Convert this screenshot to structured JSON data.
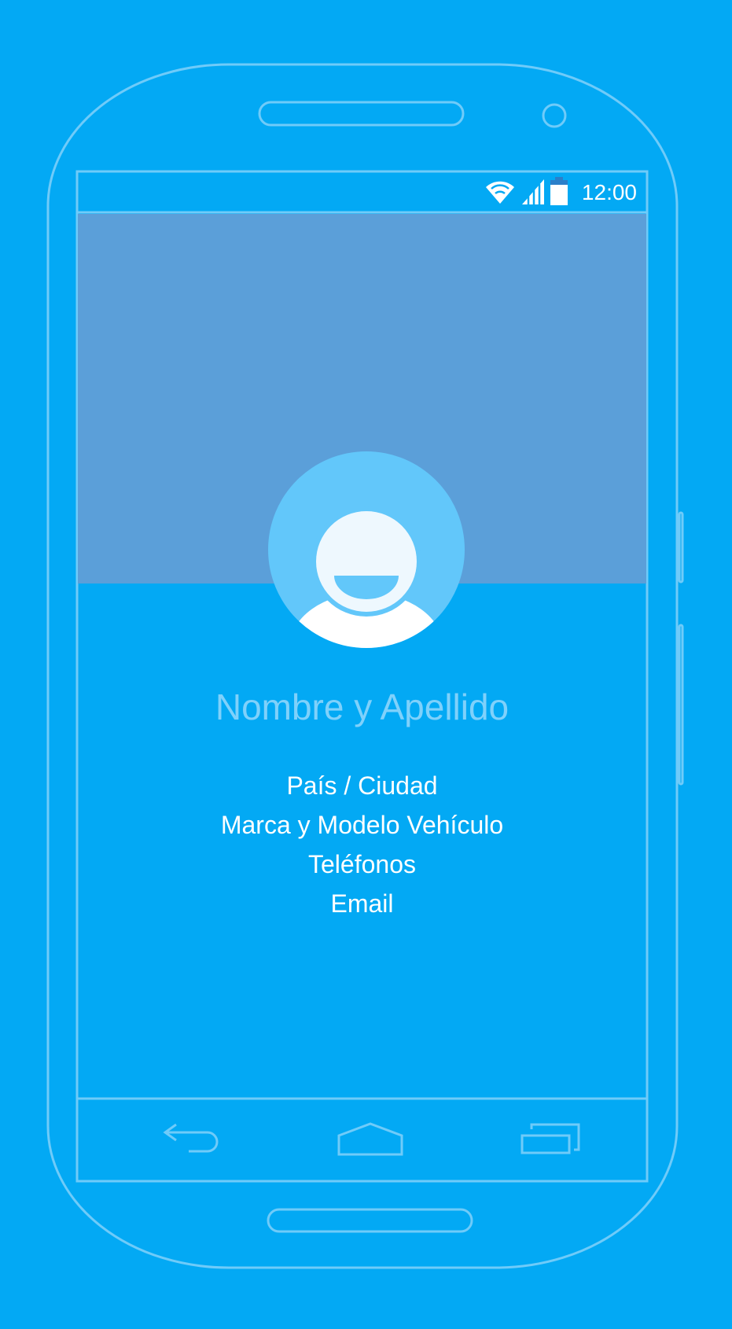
{
  "status_bar": {
    "time": "12:00",
    "icons": [
      "wifi-icon",
      "signal-icon",
      "battery-icon"
    ]
  },
  "profile": {
    "name": "Nombre y Apellido",
    "avatar_icon": "user-avatar-icon"
  },
  "info": {
    "items": [
      "País / Ciudad",
      "Marca y Modelo Vehículo",
      "Teléfonos",
      "Email"
    ]
  },
  "nav_bar": {
    "icons": [
      "back-icon",
      "home-icon",
      "recent-apps-icon"
    ]
  },
  "colors": {
    "background": "#03A9F4",
    "cover": "#5B9FD9",
    "avatar_circle": "#62C7FA",
    "outline": "#6FCBF9",
    "name_text": "#7FD1FB",
    "text": "#FFFFFF"
  }
}
